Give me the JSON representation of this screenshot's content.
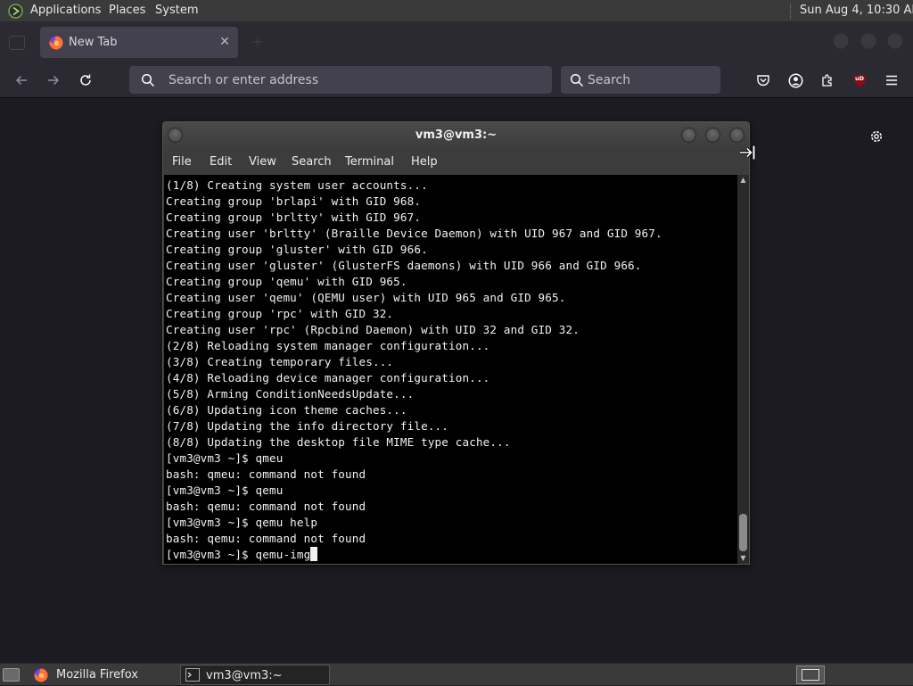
{
  "system_panel": {
    "menus": [
      "Applications",
      "Places",
      "System"
    ],
    "clock": "Sun Aug  4, 10:30 AM"
  },
  "browser": {
    "tab_title": "New Tab",
    "address_placeholder": "Search or enter address",
    "search_placeholder": "Search",
    "ublock_badge": "uD"
  },
  "terminal": {
    "title": "vm3@vm3:~",
    "menu": [
      "File",
      "Edit",
      "View",
      "Search",
      "Terminal",
      "Help"
    ],
    "lines": [
      "(1/8) Creating system user accounts...",
      "Creating group 'brlapi' with GID 968.",
      "Creating group 'brltty' with GID 967.",
      "Creating user 'brltty' (Braille Device Daemon) with UID 967 and GID 967.",
      "Creating group 'gluster' with GID 966.",
      "Creating user 'gluster' (GlusterFS daemons) with UID 966 and GID 966.",
      "Creating group 'qemu' with GID 965.",
      "Creating user 'qemu' (QEMU user) with UID 965 and GID 965.",
      "Creating group 'rpc' with GID 32.",
      "Creating user 'rpc' (Rpcbind Daemon) with UID 32 and GID 32.",
      "(2/8) Reloading system manager configuration...",
      "(3/8) Creating temporary files...",
      "(4/8) Reloading device manager configuration...",
      "(5/8) Arming ConditionNeedsUpdate...",
      "(6/8) Updating icon theme caches...",
      "(7/8) Updating the info directory file...",
      "(8/8) Updating the desktop file MIME type cache...",
      "[vm3@vm3 ~]$ qmeu",
      "bash: qmeu: command not found",
      "[vm3@vm3 ~]$ qemu",
      "bash: qemu: command not found",
      "[vm3@vm3 ~]$ qemu help",
      "bash: qemu: command not found"
    ],
    "prompt": "[vm3@vm3 ~]$ ",
    "current_input": "qemu-img"
  },
  "taskbar": {
    "tasks": [
      "Mozilla Firefox",
      "vm3@vm3:~"
    ]
  },
  "colors": {
    "panel": "#3a3a3a",
    "browser_chrome": "#2b2a33",
    "page_bg": "#1c1b22",
    "terminal_bg": "#000000",
    "terminal_fg": "#f2f2f2",
    "ublock_red": "#8b0d12"
  }
}
